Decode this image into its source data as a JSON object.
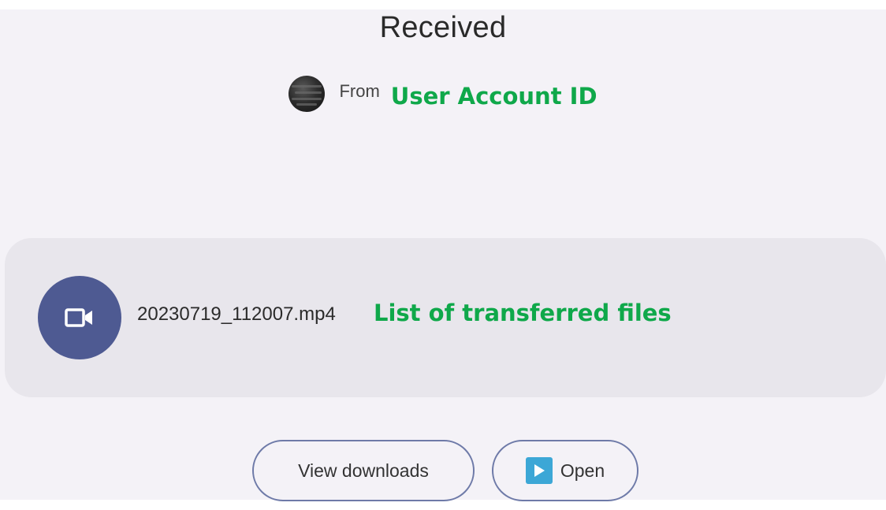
{
  "header": {
    "title": "Received"
  },
  "sender": {
    "from_label": "From",
    "annotation": "User Account ID",
    "avatar_icon": "avatar-icon"
  },
  "files": {
    "items": [
      {
        "name": "20230719_112007.mp4",
        "icon": "video-camera-icon"
      }
    ],
    "annotation": "List of transferred files"
  },
  "actions": {
    "view_downloads_label": "View downloads",
    "open_label": "Open",
    "open_icon": "play-icon"
  },
  "colors": {
    "background": "#f4f2f7",
    "card": "#e8e6ec",
    "accent": "#4e5a92",
    "annotation": "#0fa84a",
    "button_border": "#6e7aa8",
    "open_icon": "#3ca7d6"
  }
}
